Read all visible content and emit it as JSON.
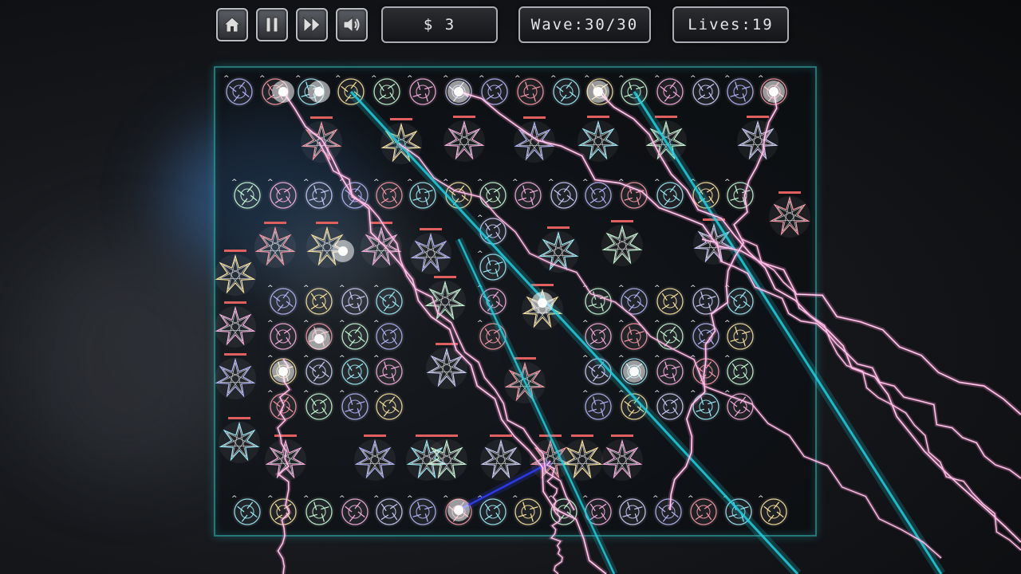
{
  "hud": {
    "money_label": "$ 3",
    "wave_label": "Wave:30/30",
    "lives_label": "Lives:19"
  },
  "buttons": {
    "home": "home-icon",
    "pause": "pause-icon",
    "fast_forward": "fast-forward-icon",
    "sound": "speaker-icon"
  },
  "colors": {
    "board_border": "#3cc8c8",
    "lightning_pink": "#ff9ad8",
    "beam_cyan": "#20d0e0",
    "beam_blue": "#3040ff"
  }
}
